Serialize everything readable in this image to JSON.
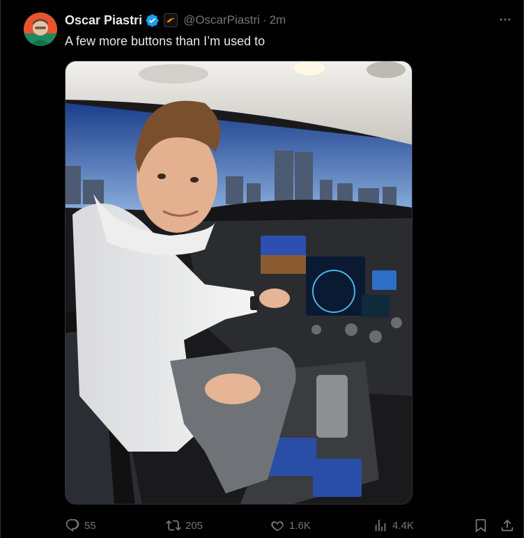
{
  "post": {
    "author": {
      "display_name": "Oscar Piastri",
      "handle": "@OscarPiastri",
      "verified_icon": "verified-badge-icon",
      "affiliate_icon": "mclaren-affiliate-icon"
    },
    "separator": "·",
    "timestamp": "2m",
    "text": "A few more buttons than I’m used to",
    "media_alt": "Oscar Piastri sitting in an airplane cockpit with the city skyline visible through the windshield",
    "metrics": {
      "replies": "55",
      "reposts": "205",
      "likes": "1.6K",
      "views": "4.4K"
    },
    "icons": {
      "more": "more-icon",
      "reply": "reply-icon",
      "repost": "repost-icon",
      "like": "heart-icon",
      "views": "views-icon",
      "bookmark": "bookmark-icon",
      "share": "share-icon"
    },
    "colors": {
      "background": "#000000",
      "text_primary": "#e7e9ea",
      "text_secondary": "#71767b",
      "verified": "#1d9bf0",
      "border": "#2f3336"
    }
  }
}
